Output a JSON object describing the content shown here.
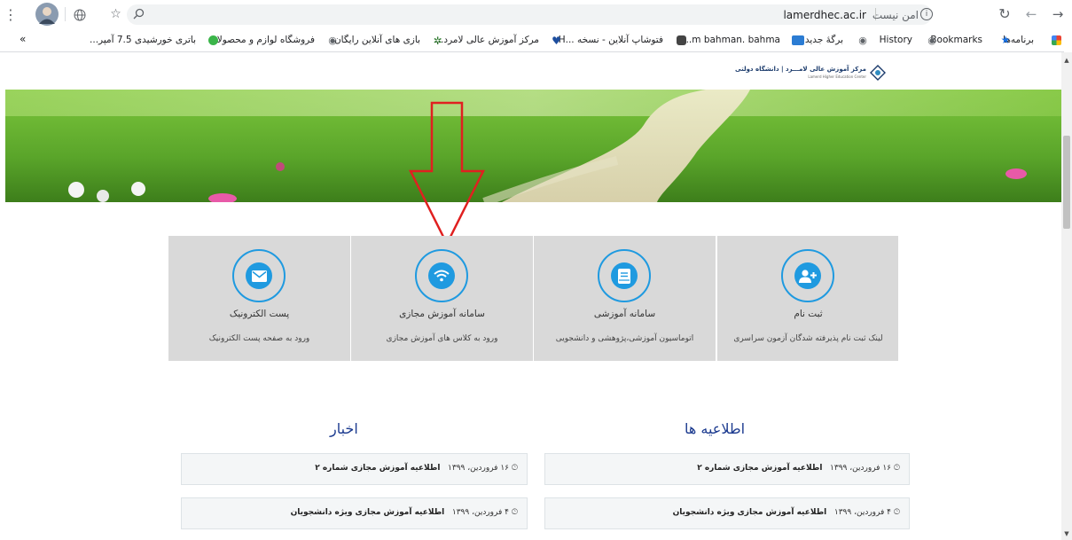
{
  "browser": {
    "url": "lamerdhec.ac.ir",
    "security_label": "امن نیست",
    "bookmarks": [
      {
        "label": "برنامه‌ها"
      },
      {
        "label": "Bookmarks"
      },
      {
        "label": "History"
      },
      {
        "label": "برگهٔ جدید"
      },
      {
        "label": "m bahman. bahma..."
      },
      {
        "label": "فتوشاپ آنلاین - نسخه ...H"
      },
      {
        "label": "مرکز آموزش عالی لامرد..."
      },
      {
        "label": "بازی های آنلاین رایگان"
      },
      {
        "label": "فروشگاه لوازم و محصولا..."
      },
      {
        "label": "باتری خورشیدی 7.5 آمپر..."
      }
    ],
    "overflow_label": "»"
  },
  "site": {
    "logo_text": "مرکز آموزش عالی لامـــرد | دانشگاه دولتی",
    "logo_sub": "Lamerd Higher Education Center"
  },
  "tiles": [
    {
      "title": "پست الکترونیک",
      "desc": "ورود به صفحه پست الکترونیک",
      "icon": "envelope-icon"
    },
    {
      "title": "سامانه آموزش مجازی",
      "desc": "ورود به کلاس های آموزش مجازی",
      "icon": "wifi-icon"
    },
    {
      "title": "سامانه آموزشی",
      "desc": "اتوماسیون آموزشی،پژوهشی و دانشجویی",
      "icon": "book-icon"
    },
    {
      "title": "ثبت نام",
      "desc": "لینک ثبت نام پذیرفته شدگان آزمون سراسری",
      "icon": "user-plus-icon"
    }
  ],
  "news": {
    "title": "اخبار",
    "items": [
      {
        "date": "۱۶ فروردین، ۱۳۹۹",
        "text": "اطلاعیه آموزش مجازی شماره ۲"
      },
      {
        "date": "۴ فروردین، ۱۳۹۹",
        "text": "اطلاعیه آموزش مجازی ویژه دانشجویان"
      }
    ]
  },
  "announcements": {
    "title": "اطلاعیه ها",
    "items": [
      {
        "date": "۱۶ فروردین، ۱۳۹۹",
        "text": "اطلاعیه آموزش مجازی شماره ۲"
      },
      {
        "date": "۴ فروردین، ۱۳۹۹",
        "text": "اطلاعیه آموزش مجازی ویژه دانشجویان"
      }
    ]
  },
  "colors": {
    "accent": "#1f9ae0",
    "heading": "#1b3a8f",
    "arrow": "#e02020",
    "tile_bg": "#d9d9d9"
  }
}
